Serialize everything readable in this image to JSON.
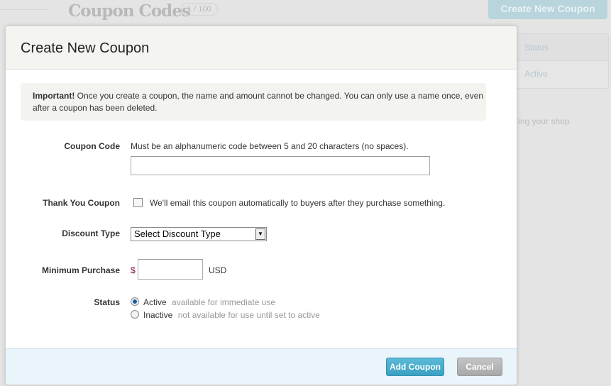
{
  "background": {
    "title": "Coupon Codes",
    "count_badge": "1 / 100",
    "create_button": "Create New Coupon",
    "table": {
      "header": "Status",
      "rows": [
        "Active"
      ]
    },
    "partial_text": "ting your shop."
  },
  "modal": {
    "title": "Create New Coupon",
    "notice": {
      "strong": "Important!",
      "text": " Once you create a coupon, the name and amount cannot be changed. You can only use a name once, even after a coupon has been deleted."
    },
    "coupon_code": {
      "label": "Coupon Code",
      "help": "Must be an alphanumeric code between 5 and 20 characters (no spaces).",
      "value": ""
    },
    "thank_you": {
      "label": "Thank You Coupon",
      "checked": false,
      "text": "We'll email this coupon automatically to buyers after they purchase something."
    },
    "discount_type": {
      "label": "Discount Type",
      "selected": "Select Discount Type"
    },
    "minimum_purchase": {
      "label": "Minimum Purchase",
      "prefix": "$",
      "value": "",
      "suffix": "USD"
    },
    "status": {
      "label": "Status",
      "options": [
        {
          "label": "Active",
          "hint": "available for immediate use",
          "selected": true
        },
        {
          "label": "Inactive",
          "hint": "not available for use until set to active",
          "selected": false
        }
      ]
    },
    "buttons": {
      "add": "Add Coupon",
      "cancel": "Cancel"
    }
  },
  "colors": {
    "primary_button": "#3aa0c2",
    "cancel_button": "#a8a8a8",
    "footer": "#e9f5fb"
  }
}
